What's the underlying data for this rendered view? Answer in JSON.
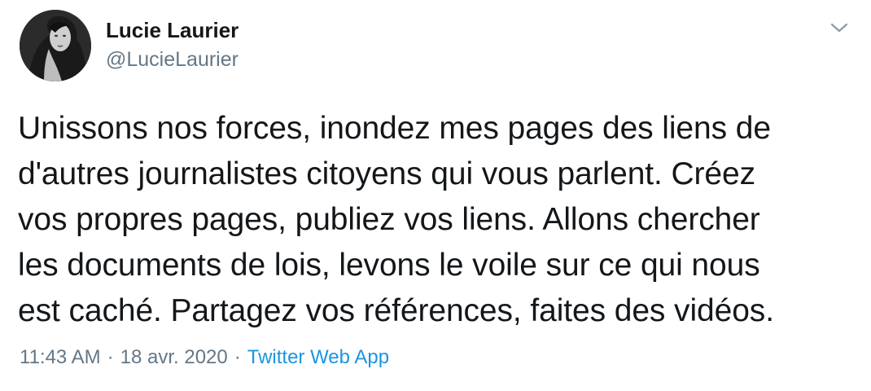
{
  "author": {
    "name": "Lucie Laurier",
    "handle": "@LucieLaurier"
  },
  "tweet": {
    "lines": [
      "Unissons nos forces, inondez mes pages des liens de",
      "d'autres journalistes citoyens qui vous parlent. Créez",
      "vos propres pages, publiez vos liens. Allons chercher",
      "les documents de lois, levons le voile sur ce qui nous",
      "est caché. Partagez vos références, faites des vidéos."
    ]
  },
  "meta": {
    "time": "11:43 AM",
    "separator": "·",
    "date": "18 avr. 2020",
    "source": "Twitter Web App"
  },
  "colors": {
    "text": "#14171a",
    "secondary": "#657786",
    "link": "#1b95e0"
  },
  "icons": {
    "menu": "chevron-down-icon"
  }
}
